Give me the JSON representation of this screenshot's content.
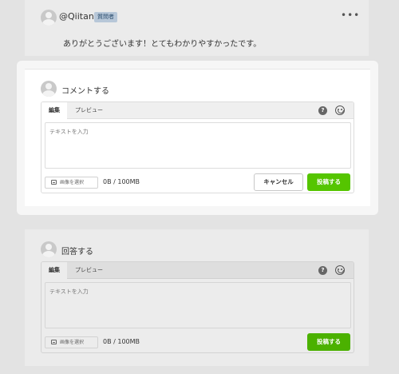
{
  "comment": {
    "username": "@Qiitan",
    "badge": "質問者",
    "more": "•••",
    "body": "ありがとうございます！とてもわかりやすかったです。"
  },
  "comment_form": {
    "title": "コメントする",
    "tab_edit": "編集",
    "tab_preview": "プレビュー",
    "help": "?",
    "placeholder": "テキストを入力",
    "image_button": "画像を選択",
    "size": "0B / 100MB",
    "cancel": "キャンセル",
    "submit": "投稿する"
  },
  "answer_form": {
    "title": "回答する",
    "tab_edit": "編集",
    "tab_preview": "プレビュー",
    "help": "?",
    "placeholder": "テキストを入力",
    "image_button": "画像を選択",
    "size": "0B / 100MB",
    "submit": "投稿する"
  },
  "colors": {
    "accent": "#55c500",
    "background": "#e3e3e3",
    "badge": "#b7c7d8"
  }
}
